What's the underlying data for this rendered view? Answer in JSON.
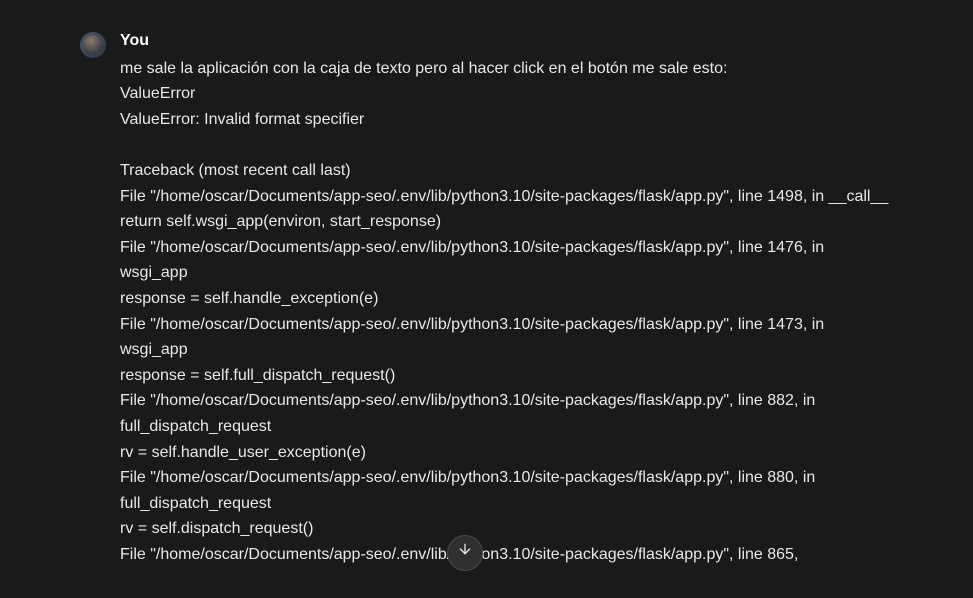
{
  "message": {
    "author": "You",
    "body": "me sale la aplicación con la caja de texto pero al hacer click en el botón me sale esto:\nValueError\nValueError: Invalid format specifier\n\nTraceback (most recent call last)\nFile \"/home/oscar/Documents/app-seo/.env/lib/python3.10/site-packages/flask/app.py\", line 1498, in __call__\nreturn self.wsgi_app(environ, start_response)\nFile \"/home/oscar/Documents/app-seo/.env/lib/python3.10/site-packages/flask/app.py\", line 1476, in wsgi_app\nresponse = self.handle_exception(e)\nFile \"/home/oscar/Documents/app-seo/.env/lib/python3.10/site-packages/flask/app.py\", line 1473, in wsgi_app\nresponse = self.full_dispatch_request()\nFile \"/home/oscar/Documents/app-seo/.env/lib/python3.10/site-packages/flask/app.py\", line 882, in full_dispatch_request\nrv = self.handle_user_exception(e)\nFile \"/home/oscar/Documents/app-seo/.env/lib/python3.10/site-packages/flask/app.py\", line 880, in full_dispatch_request\nrv = self.dispatch_request()\nFile \"/home/oscar/Documents/app-seo/.env/lib/python3.10/site-packages/flask/app.py\", line 865,"
  },
  "icons": {
    "scroll_down": "arrow-down-icon"
  }
}
